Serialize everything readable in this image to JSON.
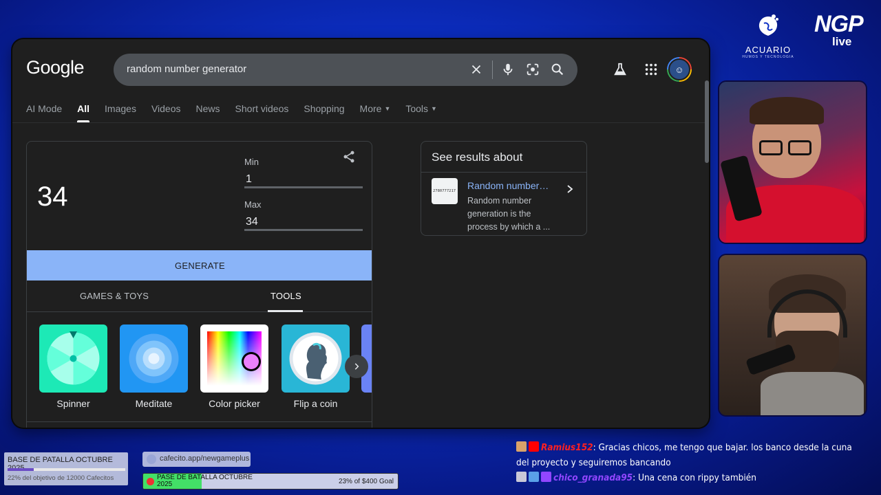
{
  "google": {
    "logo": "Google",
    "search": {
      "query": "random number generator"
    },
    "tabs": [
      {
        "label": "AI Mode"
      },
      {
        "label": "All"
      },
      {
        "label": "Images"
      },
      {
        "label": "Videos"
      },
      {
        "label": "News"
      },
      {
        "label": "Short videos"
      },
      {
        "label": "Shopping"
      },
      {
        "label": "More"
      },
      {
        "label": "Tools"
      }
    ]
  },
  "rng": {
    "result": "34",
    "min_label": "Min",
    "min_value": "1",
    "max_label": "Max",
    "max_value": "34",
    "generate_label": "GENERATE",
    "tab_games": "GAMES & TOYS",
    "tab_tools": "TOOLS",
    "tools": [
      {
        "label": "Spinner"
      },
      {
        "label": "Meditate"
      },
      {
        "label": "Color picker"
      },
      {
        "label": "Flip a coin"
      }
    ]
  },
  "see_results": {
    "title": "See results about",
    "item_title": "Random number…",
    "item_snippet": "Random number generation is the process by which a ...",
    "thumb_text": "2780777217"
  },
  "overlay": {
    "acuario_name": "ACUARIO",
    "acuario_sub": "HUMOS Y TECNOLOGIA",
    "ngp_text": "NGP",
    "ngp_sub": "live",
    "goal1_title": "BASE DE PATALLA OCTUBRE 2025",
    "goal1_progress": 0.22,
    "goal1_sub": "22% del objetivo de 12000 Cafecitos",
    "cafecito_text": "cafecito.app/newgameplus",
    "goal2_title": "PASE DE BATALLA OCTUBRE 2025",
    "goal2_progress": 0.23,
    "goal2_amount": "23% of $400 Goal"
  },
  "chat": [
    {
      "user": "Ramius152",
      "sep": ":",
      "message": " Gracias chicos, me tengo que bajar. los banco desde la cuna del proyecto y seguiremos bancando",
      "user_color": "#ff2020"
    },
    {
      "user": "chico_granada95",
      "sep": ":",
      "message": " Una cena con rippy también",
      "user_color": "#9146ff"
    }
  ],
  "colors": {
    "accent_blue": "#8ab4f8",
    "generate_bg": "#8ab4f8",
    "card_bg": "#1f1f1f"
  }
}
